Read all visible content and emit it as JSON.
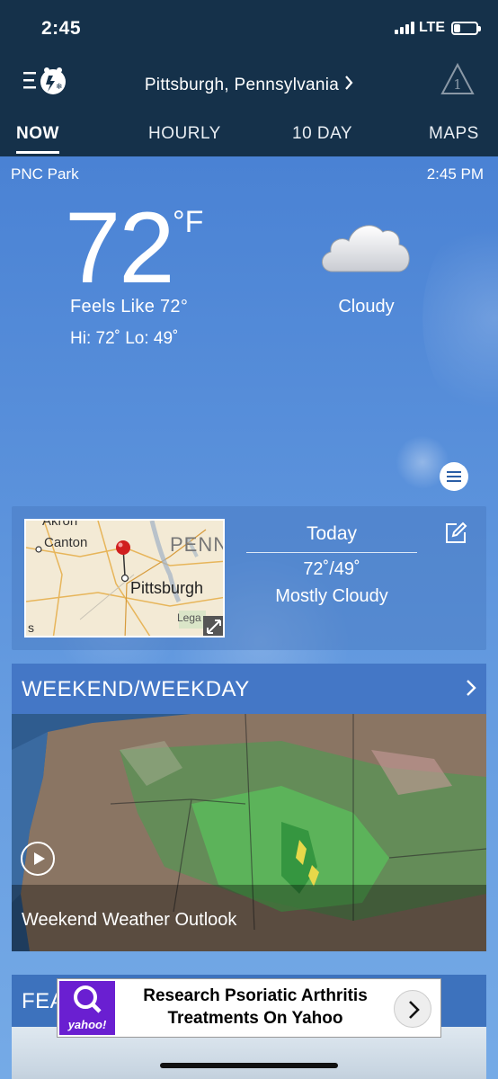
{
  "status_bar": {
    "time": "2:45",
    "network": "LTE",
    "battery_level": 0.3
  },
  "header": {
    "location": "Pittsburgh,  Pennsylvania",
    "alert_count": "1",
    "tabs": [
      "NOW",
      "HOURLY",
      "10 DAY",
      "MAPS"
    ],
    "active_tab": "NOW"
  },
  "current": {
    "place": "PNC  Park",
    "time": "2:45  PM",
    "temperature": "72",
    "unit": "°F",
    "feels_like": "Feels  Like  72°",
    "hi_lo": "Hi: 72˚  Lo: 49˚",
    "condition": "Cloudy",
    "condition_icon": "cloud-icon"
  },
  "today_card": {
    "map_labels": [
      "Canton",
      "PENN",
      "Pittsburgh",
      "Lega",
      "Akron",
      "s"
    ],
    "title": "Today",
    "temps": "72˚/49˚",
    "condition": "Mostly  Cloudy"
  },
  "weekend_card": {
    "title": "WEEKEND/WEEKDAY",
    "video_caption": "Weekend Weather Outlook"
  },
  "feature_card": {
    "title": "FEA"
  },
  "ad": {
    "logo": "yahoo!",
    "text_line1": "Research Psoriatic Arthritis",
    "text_line2": "Treatments On Yahoo"
  },
  "colors": {
    "header_bg": "#15314a",
    "sky": "#5b8fd6",
    "ad_purple": "#6a1fd1"
  }
}
